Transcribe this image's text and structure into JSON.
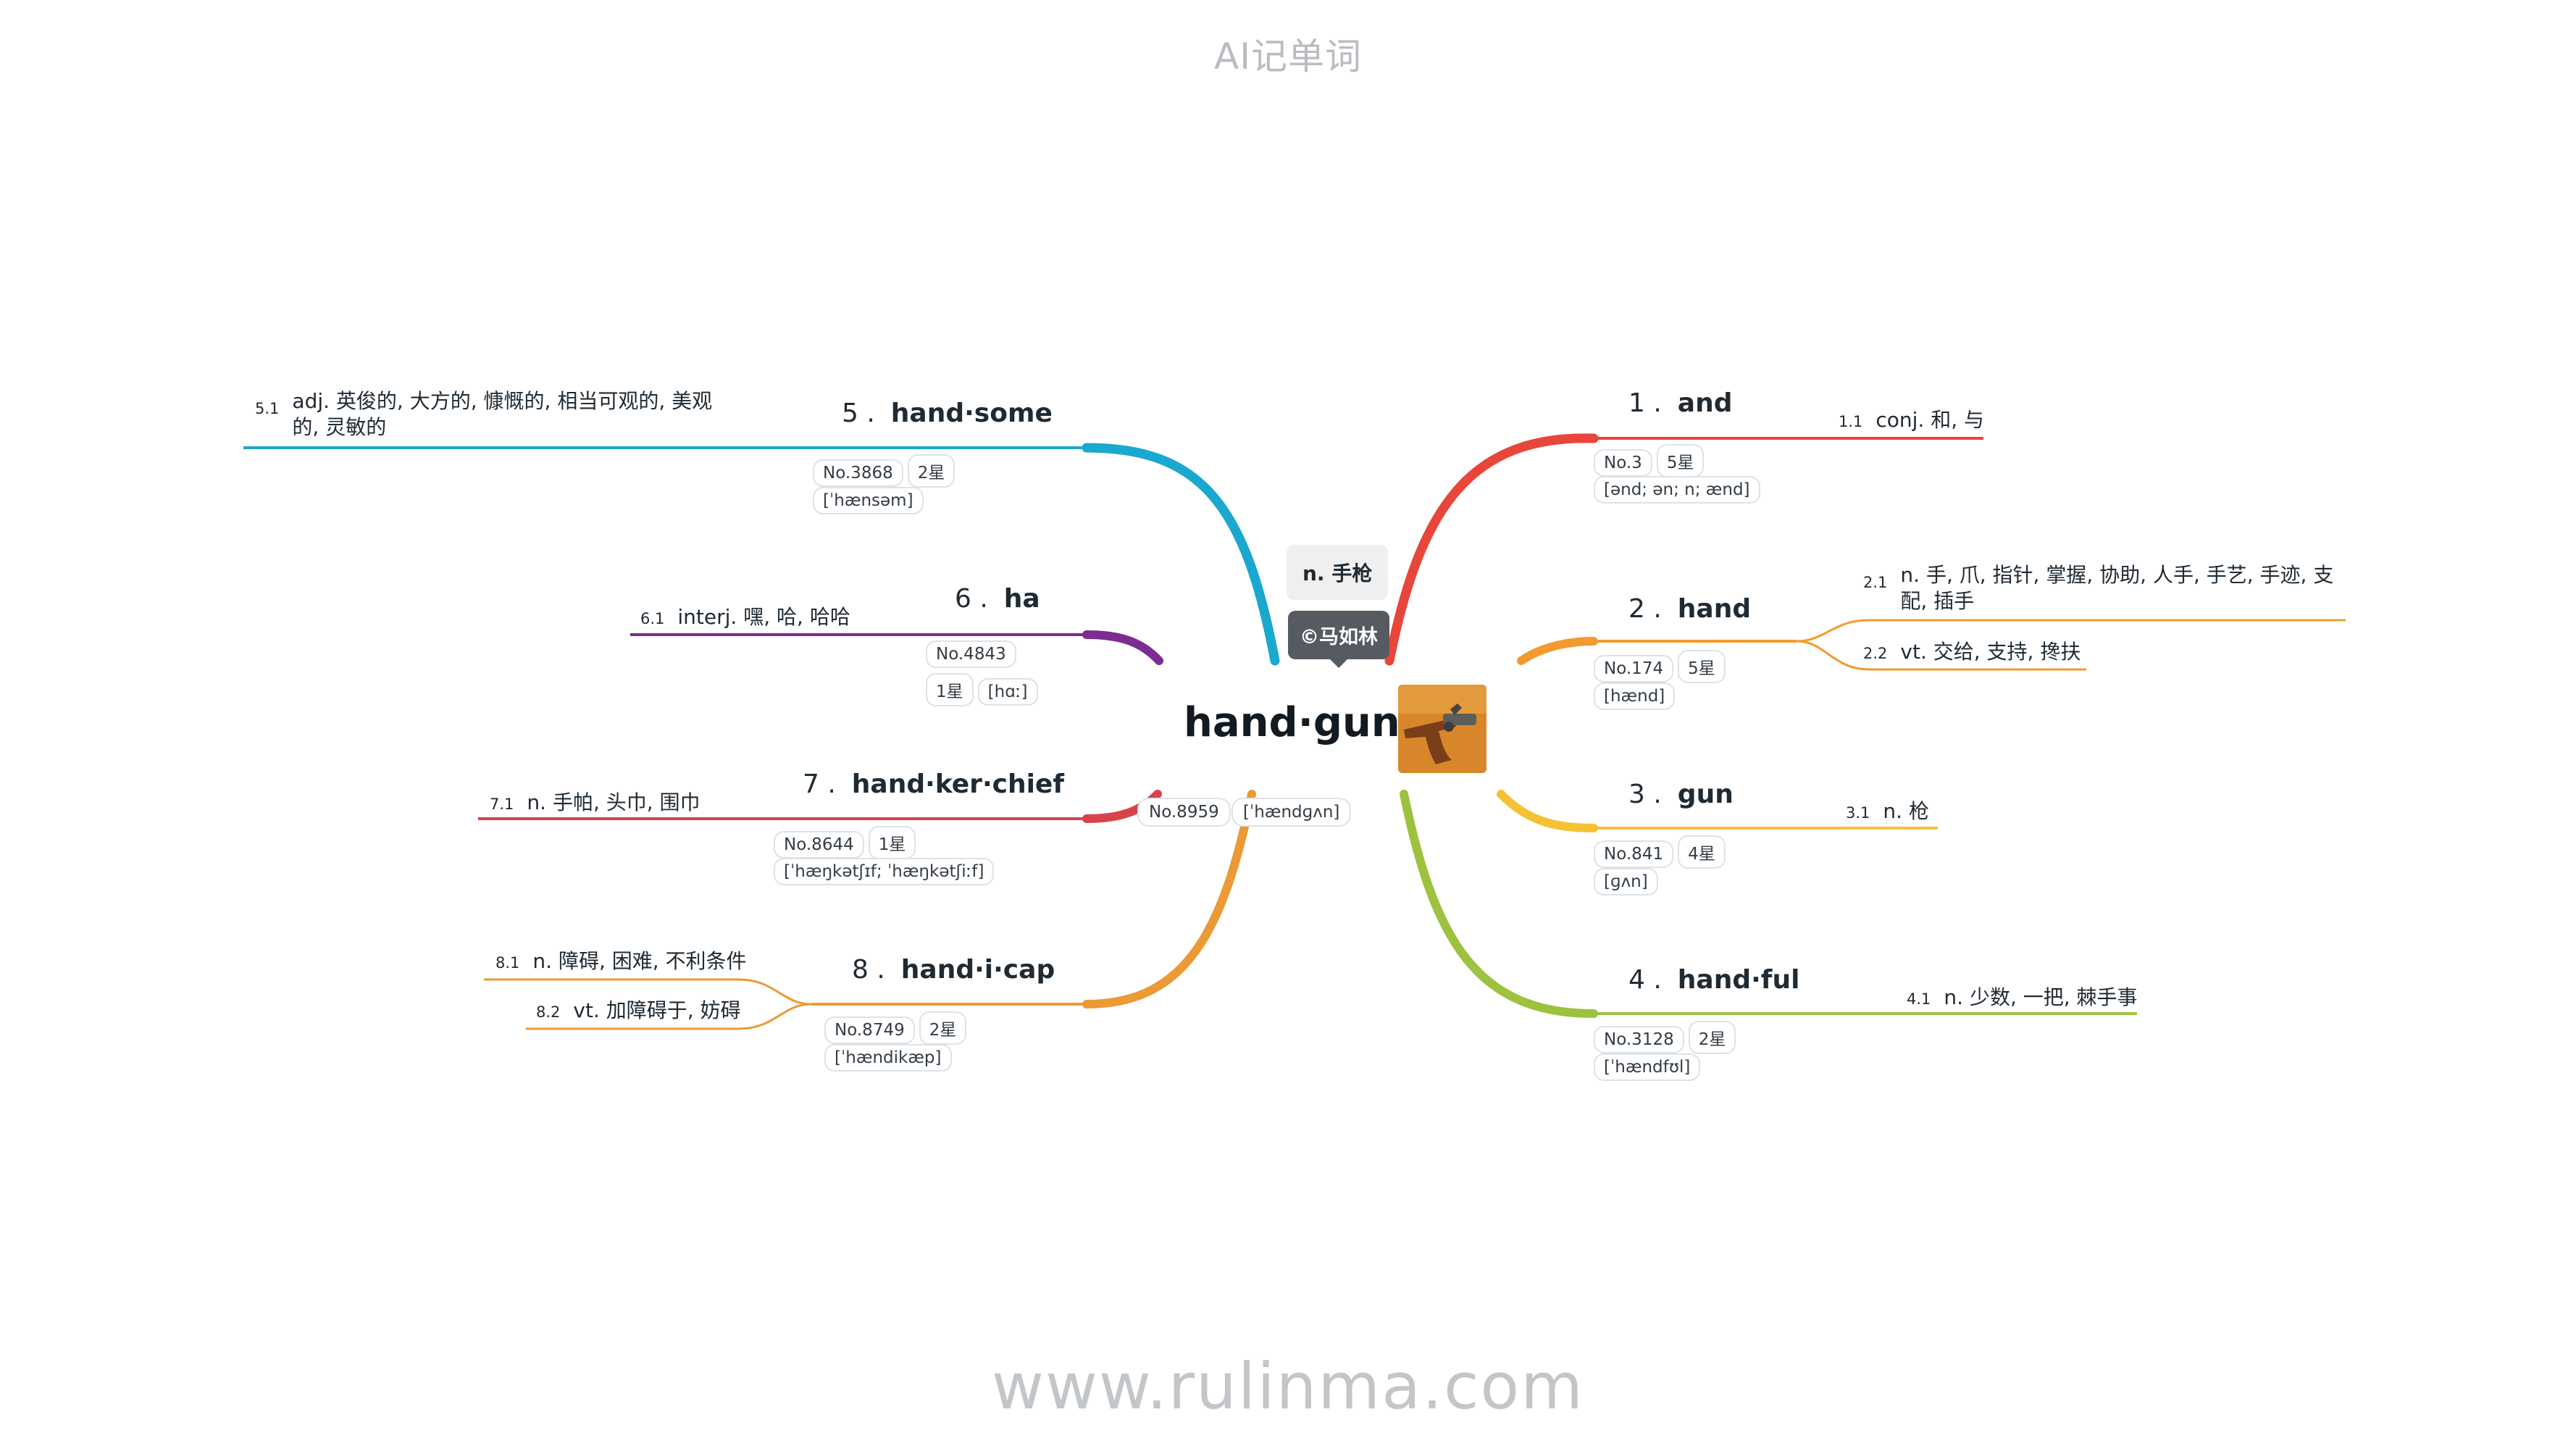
{
  "header": "AI记单词",
  "footer": "www.rulinma.com",
  "center": {
    "word": "hand·gun",
    "meaning": "n. 手枪",
    "copyright": "©马如林",
    "rank": "No.8959",
    "phonetic": "[ˈhændɡʌn]",
    "image_icon": "flintlock-pistol-icon"
  },
  "colors": {
    "red": "#e8463b",
    "orange": "#f39a2e",
    "yellow": "#f5c235",
    "green": "#9cc23f",
    "blue": "#1aa8cf",
    "purple": "#7d2c92",
    "crimson": "#d8434a",
    "amber": "#eb9a36"
  },
  "words": [
    {
      "num": "1",
      "word": "and",
      "rank": "No.3",
      "stars": "5星",
      "phonetic": "[ənd; ən; n; ænd]",
      "defs": [
        {
          "num": "1.1",
          "text": "conj. 和, 与"
        }
      ]
    },
    {
      "num": "2",
      "word": "hand",
      "rank": "No.174",
      "stars": "5星",
      "phonetic": "[hænd]",
      "defs": [
        {
          "num": "2.1",
          "text": "n. 手, 爪, 指针, 掌握, 协助, 人手, 手艺, 手迹, 支配, 插手"
        },
        {
          "num": "2.2",
          "text": "vt. 交给, 支持, 搀扶"
        }
      ]
    },
    {
      "num": "3",
      "word": "gun",
      "rank": "No.841",
      "stars": "4星",
      "phonetic": "[ɡʌn]",
      "defs": [
        {
          "num": "3.1",
          "text": "n. 枪"
        }
      ]
    },
    {
      "num": "4",
      "word": "hand·ful",
      "rank": "No.3128",
      "stars": "2星",
      "phonetic": "[ˈhændfʊl]",
      "defs": [
        {
          "num": "4.1",
          "text": "n. 少数, 一把, 棘手事"
        }
      ]
    },
    {
      "num": "5",
      "word": "hand·some",
      "rank": "No.3868",
      "stars": "2星",
      "phonetic": "[ˈhænsəm]",
      "defs": [
        {
          "num": "5.1",
          "text": "adj. 英俊的, 大方的, 慷慨的, 相当可观的, 美观的, 灵敏的"
        }
      ]
    },
    {
      "num": "6",
      "word": "ha",
      "rank": "No.4843",
      "stars": "1星",
      "phonetic": "[hɑː]",
      "defs": [
        {
          "num": "6.1",
          "text": "interj. 嘿, 哈, 哈哈"
        }
      ]
    },
    {
      "num": "7",
      "word": "hand·ker·chief",
      "rank": "No.8644",
      "stars": "1星",
      "phonetic": "[ˈhæŋkətʃɪf; ˈhæŋkətʃiːf]",
      "defs": [
        {
          "num": "7.1",
          "text": "n. 手帕, 头巾, 围巾"
        }
      ]
    },
    {
      "num": "8",
      "word": "hand·i·cap",
      "rank": "No.8749",
      "stars": "2星",
      "phonetic": "[ˈhændikæp]",
      "defs": [
        {
          "num": "8.1",
          "text": "n. 障碍, 困难, 不利条件"
        },
        {
          "num": "8.2",
          "text": "vt. 加障碍于, 妨碍"
        }
      ]
    }
  ]
}
